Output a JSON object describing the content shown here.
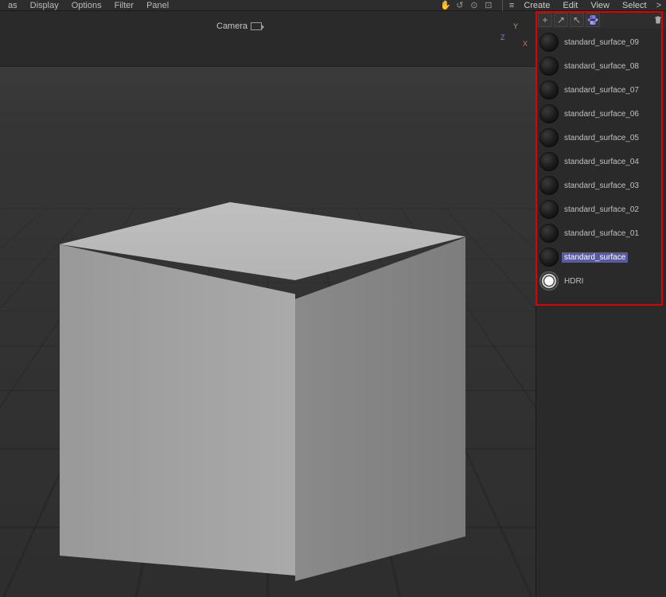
{
  "topbar": {
    "left_menus": [
      "as",
      "Display",
      "Options",
      "Filter",
      "Panel"
    ],
    "right_menus": [
      "Create",
      "Edit",
      "View",
      "Select"
    ],
    "icon_glyphs": [
      "✋",
      "↺",
      "⊙",
      "⊡"
    ]
  },
  "viewport": {
    "camera_label": "Camera"
  },
  "material_toolbar": {
    "add_glyph": "+",
    "arrow_glyph": "↗",
    "arrow2_glyph": "↖",
    "py_glyph": "ᐩ"
  },
  "materials": [
    {
      "label": "standard_surface_09",
      "selected": false,
      "kind": "sphere"
    },
    {
      "label": "standard_surface_08",
      "selected": false,
      "kind": "sphere"
    },
    {
      "label": "standard_surface_07",
      "selected": false,
      "kind": "sphere"
    },
    {
      "label": "standard_surface_06",
      "selected": false,
      "kind": "sphere"
    },
    {
      "label": "standard_surface_05",
      "selected": false,
      "kind": "sphere"
    },
    {
      "label": "standard_surface_04",
      "selected": false,
      "kind": "sphere"
    },
    {
      "label": "standard_surface_03",
      "selected": false,
      "kind": "sphere"
    },
    {
      "label": "standard_surface_02",
      "selected": false,
      "kind": "sphere"
    },
    {
      "label": "standard_surface_01",
      "selected": false,
      "kind": "sphere"
    },
    {
      "label": "standard_surface",
      "selected": true,
      "kind": "sphere"
    },
    {
      "label": "HDRI",
      "selected": false,
      "kind": "hdri"
    }
  ],
  "axis_labels": {
    "x": "X",
    "y": "Y",
    "z": "Z"
  }
}
